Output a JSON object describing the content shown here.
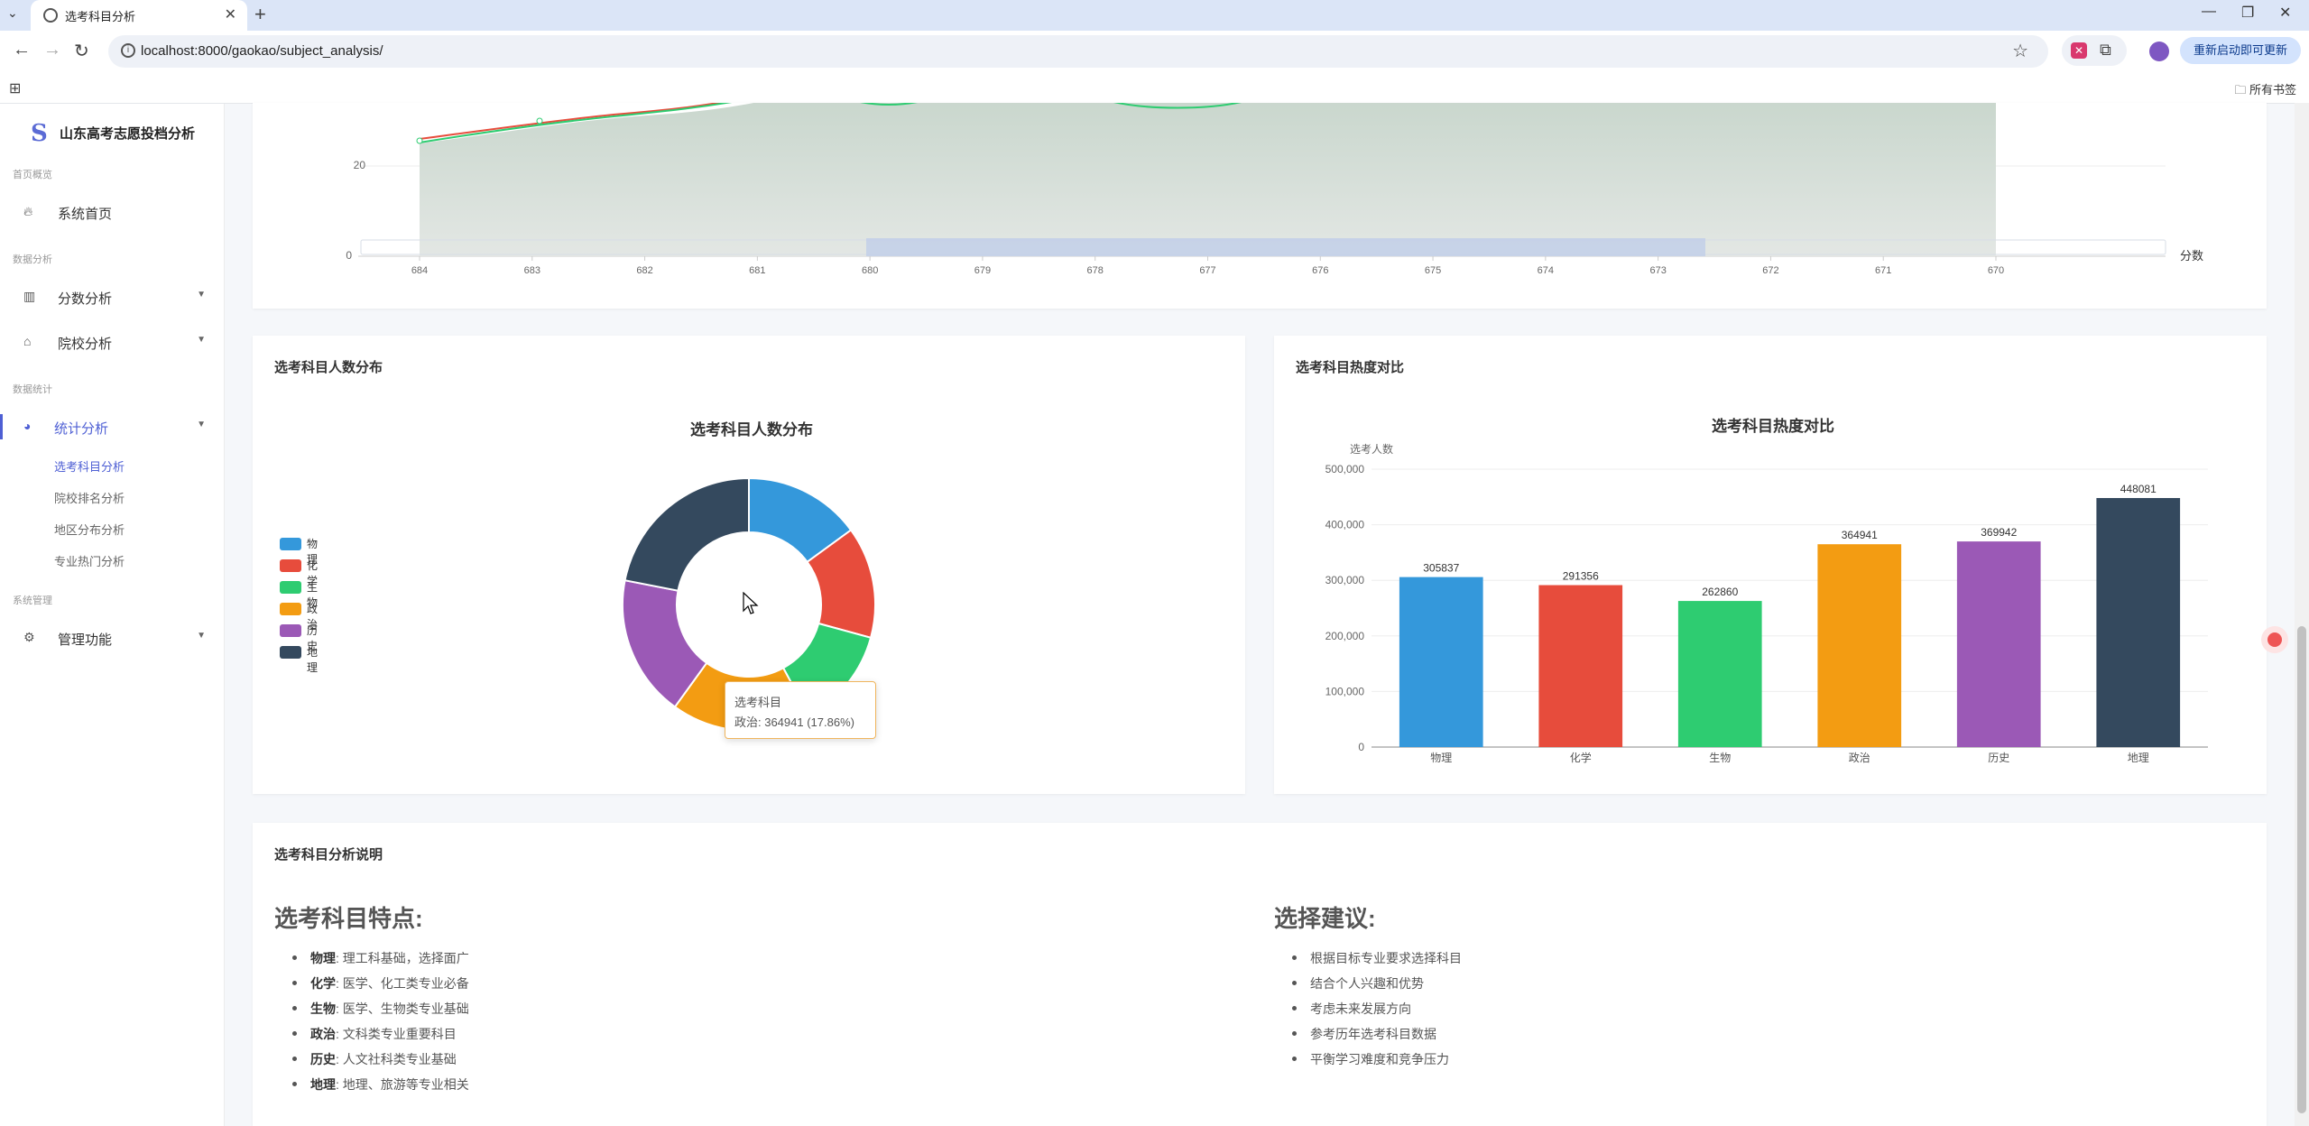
{
  "browser": {
    "tab_title": "选考科目分析",
    "url": "localhost:8000/gaokao/subject_analysis/",
    "update_label": "重新启动即可更新",
    "bookmarks_label": "所有书签"
  },
  "sidebar": {
    "brand": "山东高考志愿投档分析",
    "logo": "S",
    "sections": [
      "首页概览",
      "数据分析",
      "数据统计",
      "系统管理"
    ],
    "items": [
      {
        "label": "系统首页",
        "icon": "fire-icon"
      },
      {
        "label": "分数分析",
        "icon": "bar-chart-icon"
      },
      {
        "label": "院校分析",
        "icon": "bank-icon"
      },
      {
        "label": "统计分析",
        "icon": "pie-chart-icon"
      },
      {
        "label": "管理功能",
        "icon": "gears-icon"
      }
    ],
    "subitems": [
      "选考科目分析",
      "院校排名分析",
      "地区分布分析",
      "专业热门分析"
    ]
  },
  "top_chart": {
    "x_axis_name": "分数",
    "x_ticks": [
      "684",
      "683",
      "682",
      "681",
      "680",
      "679",
      "678",
      "677",
      "676",
      "675",
      "674",
      "673",
      "672",
      "671",
      "670"
    ],
    "y_ticks": [
      "20",
      "0"
    ]
  },
  "pie_card": {
    "card_title": "选考科目人数分布",
    "chart_title": "选考科目人数分布",
    "tooltip_title": "选考科目",
    "tooltip_value": "政治: 364941 (17.86%)"
  },
  "bar_card": {
    "card_title": "选考科目热度对比",
    "chart_title": "选考科目热度对比",
    "y_axis_name": "选考人数",
    "y_ticks": [
      "500,000",
      "400,000",
      "300,000",
      "200,000",
      "100,000",
      "0"
    ]
  },
  "chart_data": [
    {
      "type": "line",
      "x": [
        "684",
        "683",
        "682",
        "681",
        "680",
        "679",
        "678",
        "677",
        "676",
        "675",
        "674",
        "673",
        "672",
        "671",
        "670"
      ],
      "xlabel": "分数",
      "ylim": [
        0,
        60
      ]
    },
    {
      "type": "pie",
      "title": "选考科目人数分布",
      "categories": [
        "物理",
        "化学",
        "生物",
        "政治",
        "历史",
        "地理"
      ],
      "values": [
        305837,
        291356,
        262860,
        364941,
        369942,
        448081
      ],
      "colors": [
        "#3498db",
        "#e74c3c",
        "#2ecc71",
        "#f39c12",
        "#9b59b6",
        "#34495e"
      ],
      "donut": true
    },
    {
      "type": "bar",
      "title": "选考科目热度对比",
      "categories": [
        "物理",
        "化学",
        "生物",
        "政治",
        "历史",
        "地理"
      ],
      "values": [
        305837,
        291356,
        262860,
        364941,
        369942,
        448081
      ],
      "colors": [
        "#3498db",
        "#e74c3c",
        "#2ecc71",
        "#f39c12",
        "#9b59b6",
        "#34495e"
      ],
      "ylabel": "选考人数",
      "ylim": [
        0,
        500000
      ]
    }
  ],
  "explain_card": {
    "card_title": "选考科目分析说明",
    "left_heading": "选考科目特点:",
    "features": [
      {
        "name": "物理",
        "desc": ": 理工科基础，选择面广"
      },
      {
        "name": "化学",
        "desc": ": 医学、化工类专业必备"
      },
      {
        "name": "生物",
        "desc": ": 医学、生物类专业基础"
      },
      {
        "name": "政治",
        "desc": ": 文科类专业重要科目"
      },
      {
        "name": "历史",
        "desc": ": 人文社科类专业基础"
      },
      {
        "name": "地理",
        "desc": ": 地理、旅游等专业相关"
      }
    ],
    "right_heading": "选择建议:",
    "suggestions": [
      "根据目标专业要求选择科目",
      "结合个人兴趣和优势",
      "考虑未来发展方向",
      "参考历年选考科目数据",
      "平衡学习难度和竞争压力"
    ]
  }
}
